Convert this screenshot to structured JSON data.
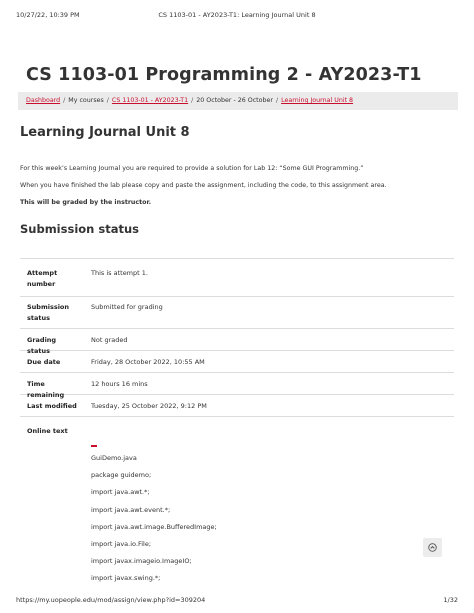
{
  "print_header": {
    "datetime": "10/27/22, 10:39 PM",
    "doc_title": "CS 1103-01 - AY2023-T1: Learning Journal Unit 8"
  },
  "course_title": "CS 1103-01 Programming 2 - AY2023-T1",
  "breadcrumb": [
    {
      "label": "Dashboard",
      "link": true
    },
    {
      "label": "My courses",
      "link": false
    },
    {
      "label": "CS 1103-01 - AY2023-T1",
      "link": true
    },
    {
      "label": "20 October - 26 October",
      "link": false
    },
    {
      "label": "Learning Journal Unit 8",
      "link": true
    }
  ],
  "page_title": "Learning Journal Unit 8",
  "intro": {
    "p1": "For this week’s Learning Journal you are required to provide a solution for Lab 12: “Some GUI Programming.”",
    "p2": "When you have finished the lab please copy and paste the assignment, including the code, to this assignment area.",
    "p3": "This will be graded by the instructor."
  },
  "submission_title": "Submission status",
  "status": {
    "attempt_label": "Attempt number",
    "attempt_value": "This is attempt 1.",
    "submission_label": "Submission status",
    "submission_value": "Submitted for grading",
    "grading_label": "Grading status",
    "grading_value": "Not graded",
    "due_label": "Due date",
    "due_value": "Friday, 28 October 2022, 10:55 AM",
    "remaining_label": "Time remaining",
    "remaining_value": "12 hours 16 mins",
    "modified_label": "Last modified",
    "modified_value": "Tuesday, 25 October 2022, 9:12 PM",
    "online_label": "Online text"
  },
  "online_text_lines": [
    "GuiDemo.java",
    "package guidemo;",
    "import java.awt.*;",
    "import java.awt.event.*;",
    "import java.awt.image.BufferedImage;",
    "import java.io.File;",
    "import javax.imageio.ImageIO;",
    "import javax.swing.*;"
  ],
  "print_footer": {
    "url": "https://my.uopeople.edu/mod/assign/view.php?id=309204",
    "page": "1/32"
  },
  "colors": {
    "accent": "#c8102e",
    "breadcrumb_bg": "#ebebeb"
  },
  "icons": {
    "scroll_top": "chevron-up-icon"
  }
}
